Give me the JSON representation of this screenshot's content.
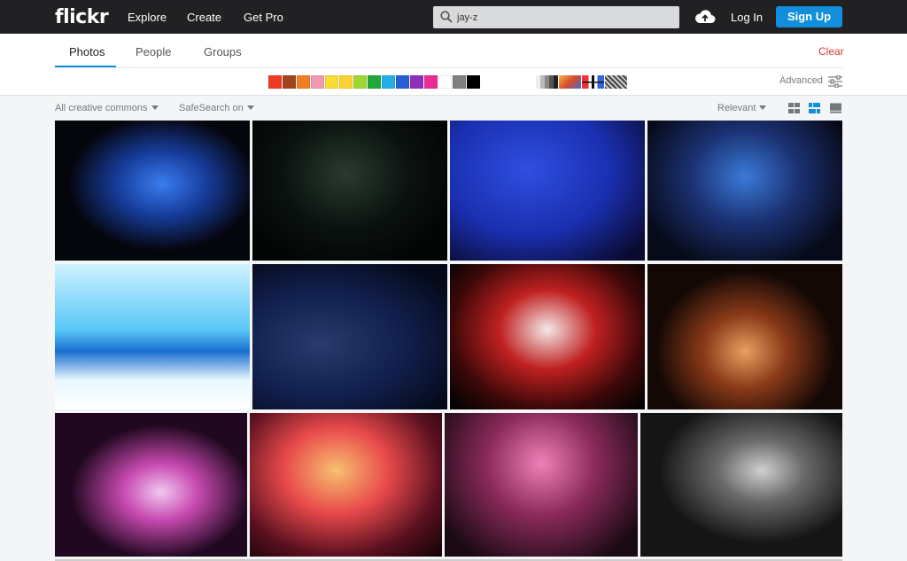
{
  "header": {
    "logo": "flickr",
    "nav": [
      "Explore",
      "Create",
      "Get Pro"
    ],
    "search_value": "jay-z",
    "login": "Log In",
    "signup": "Sign Up"
  },
  "tabs": [
    {
      "label": "Photos",
      "active": true
    },
    {
      "label": "People",
      "active": false
    },
    {
      "label": "Groups",
      "active": false
    }
  ],
  "clear_label": "Clear",
  "advanced_label": "Advanced",
  "colors": [
    "#ef3b24",
    "#a0451e",
    "#f07f23",
    "#f29ab3",
    "#fbdc35",
    "#fbd133",
    "#a0d631",
    "#23a63c",
    "#22aee6",
    "#2560d4",
    "#8e30b9",
    "#ea2c93",
    "#ffffff",
    "#808080",
    "#000000"
  ],
  "filters": {
    "license": "All creative commons",
    "safesearch": "SafeSearch on",
    "sort": "Relevant"
  },
  "photos": [
    {
      "label": "concert-photo-1",
      "colors": [
        "#0a0a12",
        "#2a5bd8",
        "#0b0b1a"
      ]
    },
    {
      "label": "concert-photo-2",
      "colors": [
        "#04090a",
        "#1b2a22",
        "#050806"
      ]
    },
    {
      "label": "concert-photo-3",
      "colors": [
        "#1a34c6",
        "#1d2fa8",
        "#050512"
      ]
    },
    {
      "label": "concert-photo-4",
      "colors": [
        "#0b1a3a",
        "#2a6ac8",
        "#0c1020"
      ]
    },
    {
      "label": "concert-photo-5",
      "colors": [
        "#a8e6ff",
        "#1a8ee8",
        "#ffffff"
      ]
    },
    {
      "label": "concert-photo-6",
      "colors": [
        "#0a1a3a",
        "#1c2d6a",
        "#050a18"
      ]
    },
    {
      "label": "concert-photo-7",
      "colors": [
        "#b01010",
        "#f0e8e8",
        "#0a0505"
      ]
    },
    {
      "label": "concert-photo-8",
      "colors": [
        "#0a0505",
        "#c66a2a",
        "#140a05"
      ]
    },
    {
      "label": "concert-photo-9",
      "colors": [
        "#1a0a1a",
        "#d84ab8",
        "#050305"
      ]
    },
    {
      "label": "concert-photo-10",
      "colors": [
        "#c8283a",
        "#f08a4a",
        "#1a0508"
      ]
    },
    {
      "label": "concert-photo-11",
      "colors": [
        "#c83a7a",
        "#6a2a4a",
        "#150a12"
      ]
    },
    {
      "label": "concert-photo-12",
      "colors": [
        "#050505",
        "#c8c8c8",
        "#1a1a1a"
      ]
    }
  ]
}
